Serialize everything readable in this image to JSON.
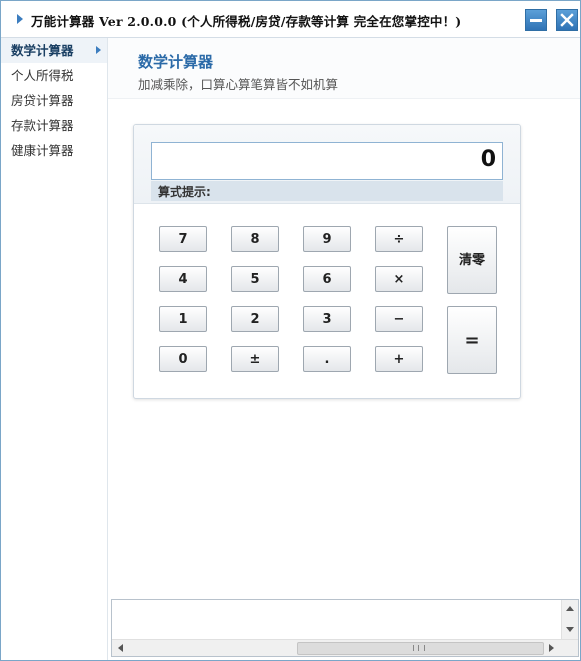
{
  "window": {
    "title": "万能计算器 Ver 2.0.0.0 (个人所得税/房贷/存款等计算 完全在您掌控中！)",
    "minimize_icon": "minimize-icon",
    "close_icon": "close-icon",
    "accent_color": "#2f73b5"
  },
  "sidebar": {
    "items": [
      {
        "label": "数学计算器",
        "active": true
      },
      {
        "label": "个人所得税",
        "active": false
      },
      {
        "label": "房贷计算器",
        "active": false
      },
      {
        "label": "存款计算器",
        "active": false
      },
      {
        "label": "健康计算器",
        "active": false
      }
    ]
  },
  "header": {
    "title": "数学计算器",
    "subtitle": "加减乘除，口算心算笔算皆不如机算"
  },
  "calculator": {
    "display_value": "0",
    "hint_label": "算式提示:",
    "keys": {
      "k7": "7",
      "k8": "8",
      "k9": "9",
      "div": "÷",
      "k4": "4",
      "k5": "5",
      "k6": "6",
      "mul": "×",
      "k1": "1",
      "k2": "2",
      "k3": "3",
      "sub": "−",
      "k0": "0",
      "sign": "±",
      "dot": ".",
      "add": "+",
      "clear": "清零",
      "equals": "="
    }
  },
  "bottom_text": ""
}
